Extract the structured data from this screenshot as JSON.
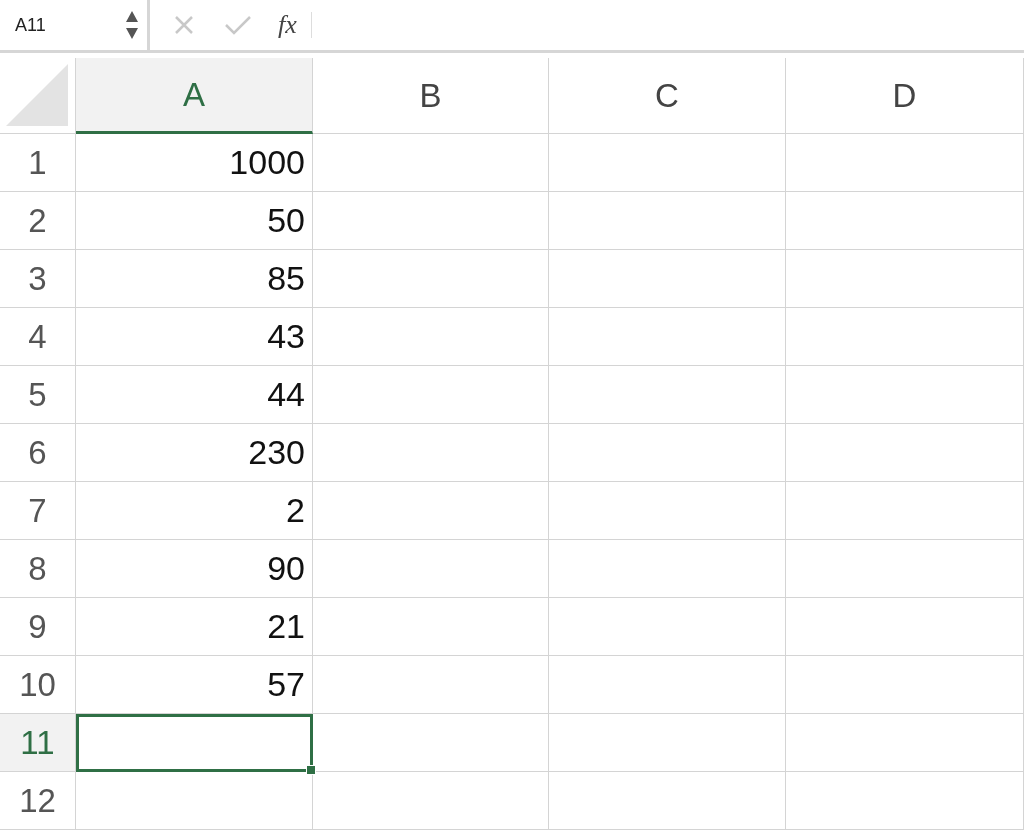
{
  "name_box": "A11",
  "formula_bar": {
    "function_label": "fx",
    "cancel_disabled": true,
    "enter_disabled": true
  },
  "columns": [
    {
      "label": "A",
      "selected": true
    },
    {
      "label": "B",
      "selected": false
    },
    {
      "label": "C",
      "selected": false
    },
    {
      "label": "D",
      "selected": false
    }
  ],
  "rows": [
    {
      "label": "1",
      "selected": false,
      "a": "1000"
    },
    {
      "label": "2",
      "selected": false,
      "a": "50"
    },
    {
      "label": "3",
      "selected": false,
      "a": "85"
    },
    {
      "label": "4",
      "selected": false,
      "a": "43"
    },
    {
      "label": "5",
      "selected": false,
      "a": "44"
    },
    {
      "label": "6",
      "selected": false,
      "a": "230"
    },
    {
      "label": "7",
      "selected": false,
      "a": "2"
    },
    {
      "label": "8",
      "selected": false,
      "a": "90"
    },
    {
      "label": "9",
      "selected": false,
      "a": "21"
    },
    {
      "label": "10",
      "selected": false,
      "a": "57"
    },
    {
      "label": "11",
      "selected": true
    },
    {
      "label": "12",
      "selected": false
    }
  ]
}
